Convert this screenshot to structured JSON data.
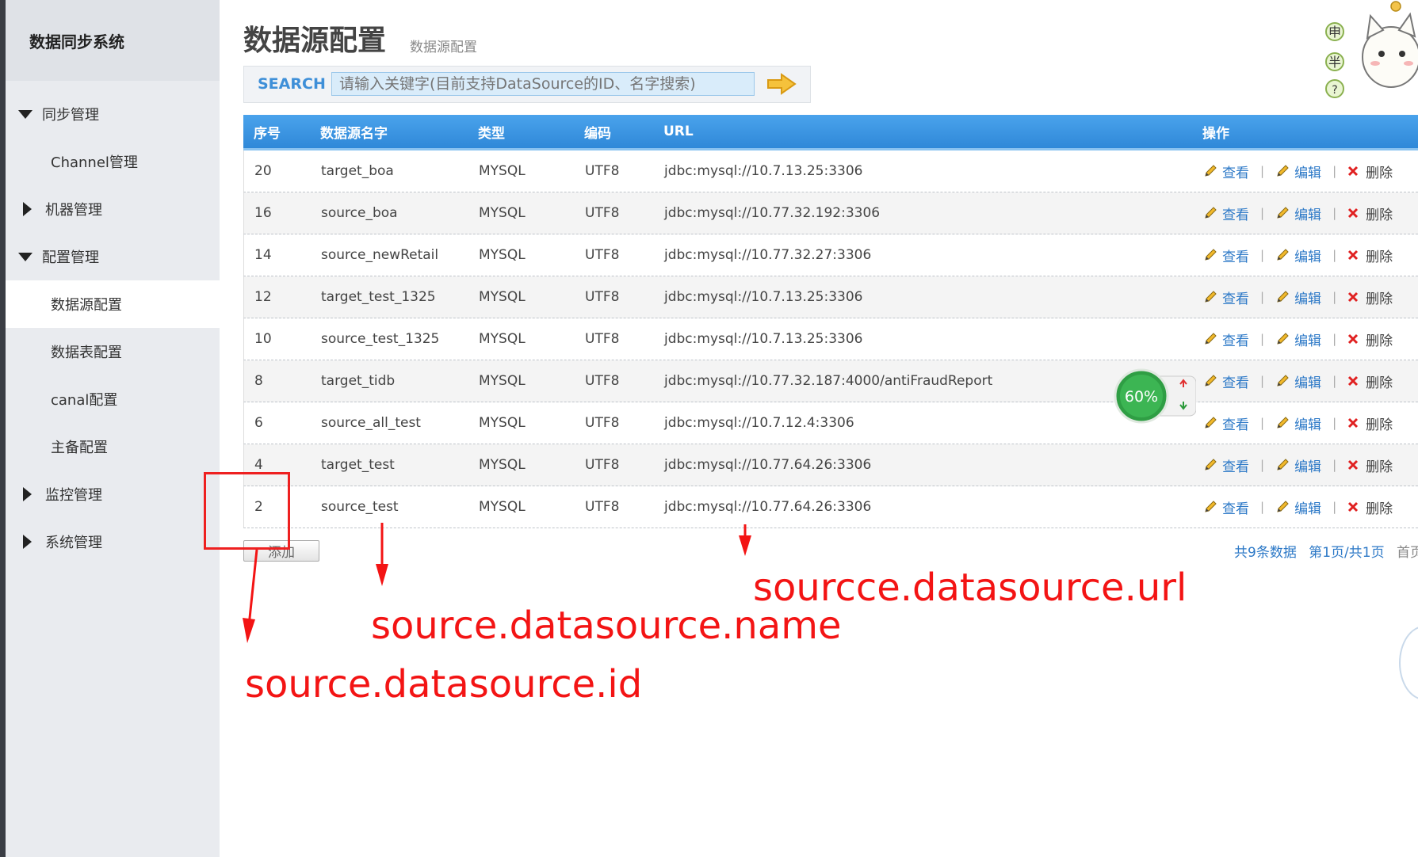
{
  "sidebar": {
    "title": "数据同步系统",
    "sync": "同步管理",
    "channel": "Channel管理",
    "machine": "机器管理",
    "config": "配置管理",
    "datasource": "数据源配置",
    "datatable": "数据表配置",
    "canal": "canal配置",
    "standby": "主备配置",
    "monitor": "监控管理",
    "system": "系统管理"
  },
  "page": {
    "title": "数据源配置",
    "subtitle": "数据源配置"
  },
  "search": {
    "label": "SEARCH",
    "placeholder": "请输入关键字(目前支持DataSource的ID、名字搜索)"
  },
  "cat_chars": [
    "申",
    "半",
    "?"
  ],
  "table": {
    "headers": {
      "id": "序号",
      "name": "数据源名字",
      "type": "类型",
      "encoding": "编码",
      "url": "URL",
      "ops": "操作"
    },
    "rows": [
      {
        "id": "20",
        "name": "target_boa",
        "type": "MYSQL",
        "encoding": "UTF8",
        "url": "jdbc:mysql://10.7.13.25:3306"
      },
      {
        "id": "16",
        "name": "source_boa",
        "type": "MYSQL",
        "encoding": "UTF8",
        "url": "jdbc:mysql://10.77.32.192:3306"
      },
      {
        "id": "14",
        "name": "source_newRetail",
        "type": "MYSQL",
        "encoding": "UTF8",
        "url": "jdbc:mysql://10.77.32.27:3306"
      },
      {
        "id": "12",
        "name": "target_test_1325",
        "type": "MYSQL",
        "encoding": "UTF8",
        "url": "jdbc:mysql://10.7.13.25:3306"
      },
      {
        "id": "10",
        "name": "source_test_1325",
        "type": "MYSQL",
        "encoding": "UTF8",
        "url": "jdbc:mysql://10.7.13.25:3306"
      },
      {
        "id": "8",
        "name": "target_tidb",
        "type": "MYSQL",
        "encoding": "UTF8",
        "url": "jdbc:mysql://10.77.32.187:4000/antiFraudReport"
      },
      {
        "id": "6",
        "name": "source_all_test",
        "type": "MYSQL",
        "encoding": "UTF8",
        "url": "jdbc:mysql://10.7.12.4:3306"
      },
      {
        "id": "4",
        "name": "target_test",
        "type": "MYSQL",
        "encoding": "UTF8",
        "url": "jdbc:mysql://10.77.64.26:3306"
      },
      {
        "id": "2",
        "name": "source_test",
        "type": "MYSQL",
        "encoding": "UTF8",
        "url": "jdbc:mysql://10.77.64.26:3306"
      }
    ],
    "ops": {
      "view": "查看",
      "edit": "编辑",
      "delete": "删除",
      "sep": "|"
    }
  },
  "add_button": "添加",
  "pager": {
    "total": "共9条数据",
    "page": "第1页/共1页",
    "first": "首页"
  },
  "widget": {
    "percent": "60%"
  },
  "annotations": {
    "url": "sourcce.datasource.url",
    "name": "source.datasource.name",
    "id": "source.datasource.id"
  },
  "colors": {
    "header_blue": "#2f88d8",
    "link_blue": "#2d79c7",
    "annotation_red": "#f31414",
    "delete_red": "#e02020"
  }
}
